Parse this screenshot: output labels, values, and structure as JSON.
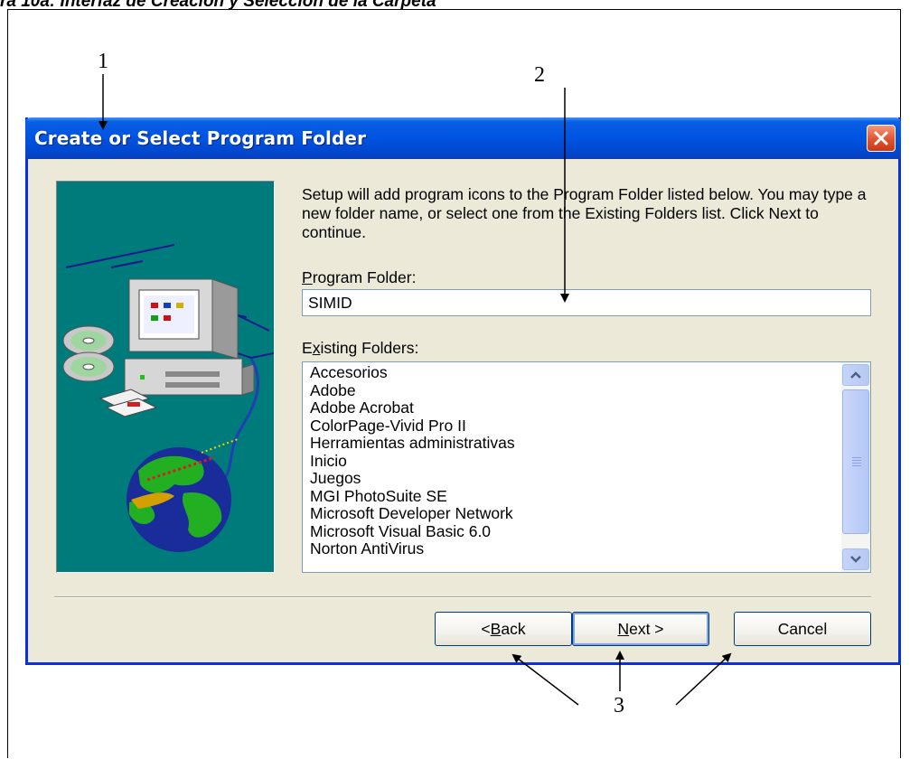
{
  "caption": "ra 10a: Interfaz de Creación y Selección de la Carpeta",
  "annotations": {
    "one": "1",
    "two": "2",
    "three": "3"
  },
  "dialog": {
    "title": "Create or Select Program Folder",
    "instructions": "Setup will add program icons to the Program Folder listed below. You may type a new folder name, or select one from the Existing Folders list.  Click Next to continue.",
    "program_folder_label": {
      "mnemonic": "P",
      "rest": "rogram Folder:"
    },
    "program_folder_value": "SIMID",
    "existing_folders_label": {
      "pre": "E",
      "mnemonic": "x",
      "rest": "isting Folders:"
    },
    "existing_folders": [
      "Accesorios",
      "Adobe",
      "Adobe Acrobat",
      "ColorPage-Vivid Pro II",
      "Herramientas administrativas",
      "Inicio",
      "Juegos",
      "MGI PhotoSuite SE",
      "Microsoft Developer Network",
      "Microsoft Visual Basic 6.0",
      "Norton AntiVirus"
    ],
    "buttons": {
      "back": {
        "pre": "< ",
        "mnemonic": "B",
        "rest": "ack"
      },
      "next": {
        "pre": "",
        "mnemonic": "N",
        "rest": "ext >"
      },
      "cancel": "Cancel"
    }
  },
  "colors": {
    "title_bar": "#0054e3",
    "close_button": "#e0532e",
    "art_panel": "#007b7b",
    "dialog_bg": "#ece9d8"
  },
  "icons": [
    "close-icon",
    "computer-illustration",
    "globe-illustration",
    "cd-icon",
    "floppy-icon",
    "scroll-up-icon",
    "scroll-down-icon"
  ]
}
